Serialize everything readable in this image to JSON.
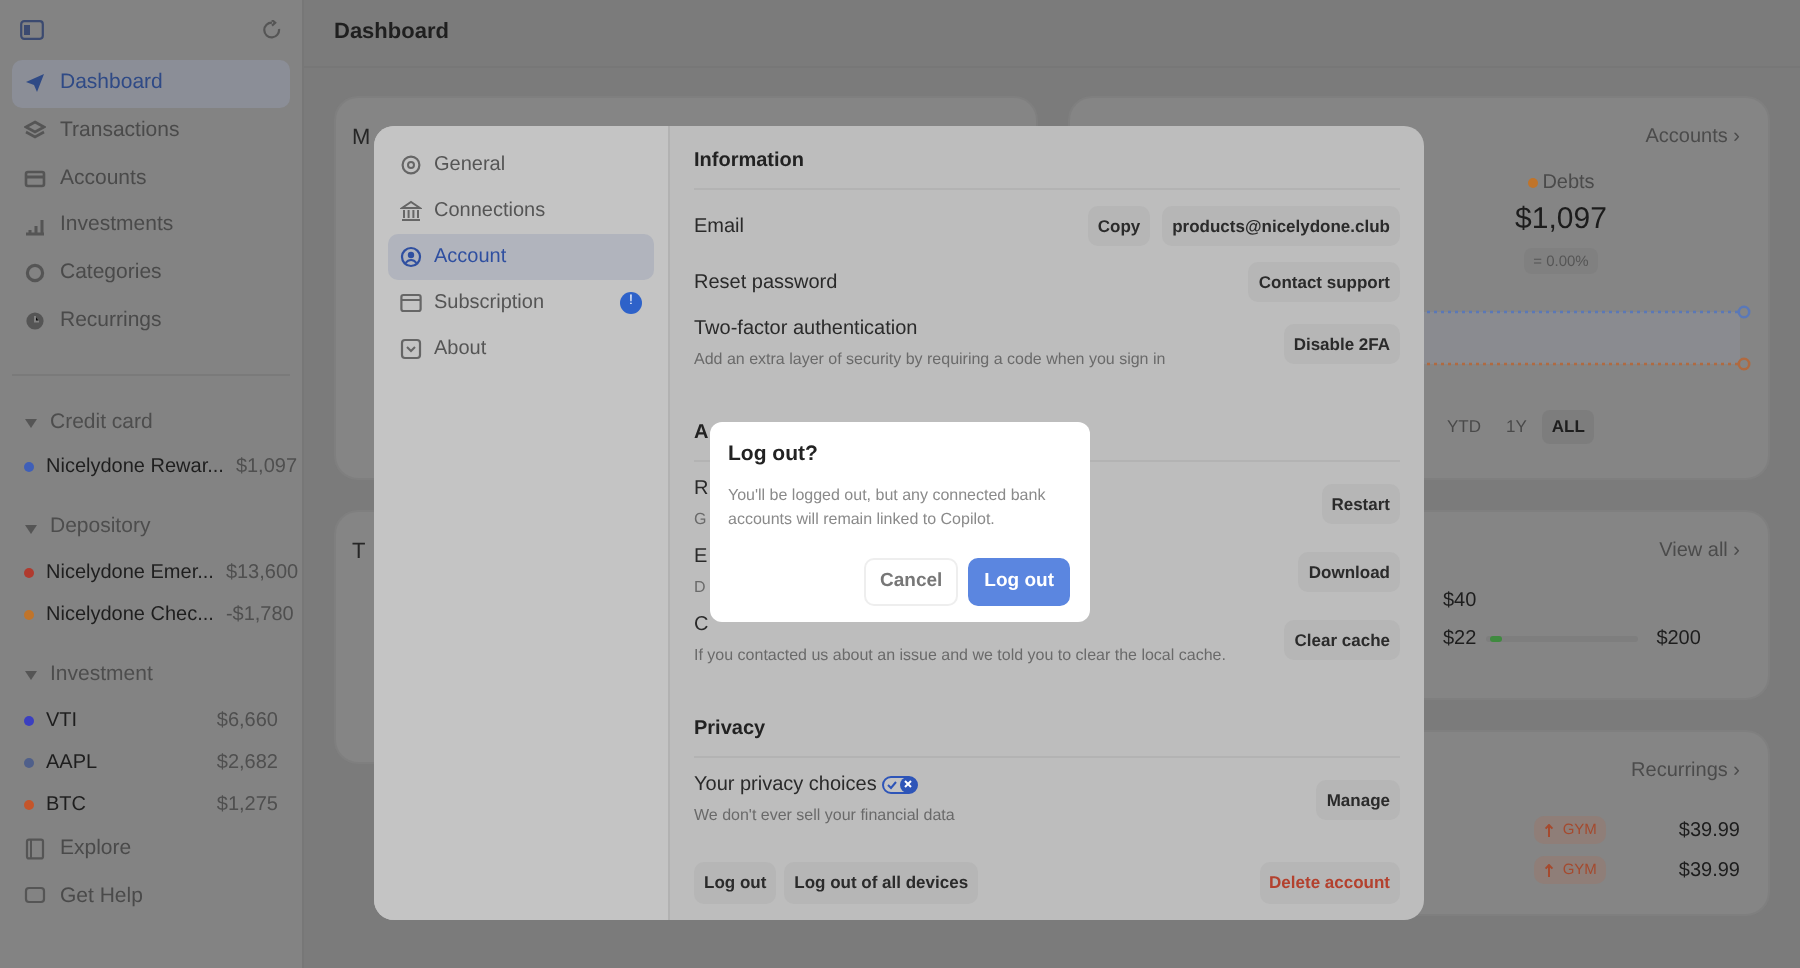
{
  "sidebar": {
    "nav": [
      {
        "label": "Dashboard",
        "selected": true
      },
      {
        "label": "Transactions",
        "selected": false
      },
      {
        "label": "Accounts",
        "selected": false
      },
      {
        "label": "Investments",
        "selected": false
      },
      {
        "label": "Categories",
        "selected": false
      },
      {
        "label": "Recurrings",
        "selected": false
      }
    ],
    "groups": [
      {
        "label": "Credit card",
        "expanded": true,
        "accounts": [
          {
            "name": "Nicelydone Rewar...",
            "amount": "$1,097",
            "color": "#3f5fb8"
          }
        ]
      },
      {
        "label": "Depository",
        "expanded": true,
        "accounts": [
          {
            "name": "Nicelydone Emer...",
            "amount": "$13,600",
            "color": "#b03a2e"
          },
          {
            "name": "Nicelydone Chec...",
            "amount": "-$1,780",
            "color": "#c0742a"
          }
        ]
      },
      {
        "label": "Investment",
        "expanded": true,
        "accounts": [
          {
            "name": "VTI",
            "amount": "$6,660",
            "color": "#3b3fc0"
          },
          {
            "name": "AAPL",
            "amount": "$2,682",
            "color": "#4f5f8a"
          },
          {
            "name": "BTC",
            "amount": "$1,275",
            "color": "#c4552a"
          }
        ]
      }
    ],
    "footer": [
      {
        "label": "Explore"
      },
      {
        "label": "Get Help"
      }
    ]
  },
  "header": {
    "title": "Dashboard"
  },
  "cards": [
    {
      "kind": "partial",
      "title": "M"
    },
    {
      "kind": "networth",
      "link": "Accounts ›",
      "legend": [
        {
          "label": "Debts",
          "color": "#c0742a"
        }
      ],
      "value": "$1,097",
      "change": "= 0.00%",
      "ranges": [
        {
          "label": "YTD",
          "selected": false
        },
        {
          "label": "1Y",
          "selected": false
        },
        {
          "label": "ALL",
          "selected": true
        }
      ]
    },
    {
      "kind": "partial",
      "title": "T"
    },
    {
      "kind": "budget",
      "link": "View all ›",
      "top": "$40",
      "spent": "$22",
      "level": 0.07,
      "limit": "$200"
    },
    {
      "kind": "recurrings",
      "link": "Recurrings ›",
      "rows": [
        {
          "tag": "GYM",
          "amount": "$39.99"
        },
        {
          "tag": "GYM",
          "amount": "$39.99"
        }
      ]
    }
  ],
  "settings": {
    "nav": [
      {
        "label": "General",
        "selected": false
      },
      {
        "label": "Connections",
        "selected": false
      },
      {
        "label": "Account",
        "selected": true
      },
      {
        "label": "Subscription",
        "selected": false,
        "badge": "!"
      },
      {
        "label": "About",
        "selected": false
      }
    ],
    "sections": [
      {
        "title": "Information",
        "rows": [
          {
            "label": "Email",
            "actions": [
              "Copy",
              "products@nicelydone.club"
            ]
          },
          {
            "label": "Reset password",
            "actions": [
              "Contact support"
            ]
          },
          {
            "label": "Two-factor authentication",
            "description": "Add an extra layer of security by requiring a code when you sign in",
            "actions": [
              "Disable 2FA"
            ]
          }
        ]
      },
      {
        "title": "A",
        "rows": [
          {
            "label": "R",
            "description": "G",
            "actions": [
              "Restart"
            ]
          },
          {
            "label": "E",
            "description": "D",
            "actions": [
              "Download"
            ]
          },
          {
            "label": "C",
            "description": "If you contacted us about an issue and we told you to clear the local cache.",
            "actions": [
              "Clear cache"
            ]
          }
        ]
      },
      {
        "title": "Privacy",
        "rows": [
          {
            "label": "Your privacy choices",
            "privacy_icon": true,
            "description": "We don't ever sell your financial data",
            "actions": [
              "Manage"
            ]
          }
        ]
      }
    ],
    "footer": [
      {
        "label": "Log out",
        "kind": "plain"
      },
      {
        "label": "Log out of all devices",
        "kind": "plain"
      },
      {
        "label": "Delete account",
        "kind": "danger"
      }
    ]
  },
  "dialog": {
    "title": "Log out?",
    "message": "You'll be logged out, but any connected bank accounts will remain linked to Copilot.",
    "buttons": [
      {
        "label": "Cancel",
        "kind": "secondary"
      },
      {
        "label": "Log out",
        "kind": "primary"
      }
    ]
  }
}
